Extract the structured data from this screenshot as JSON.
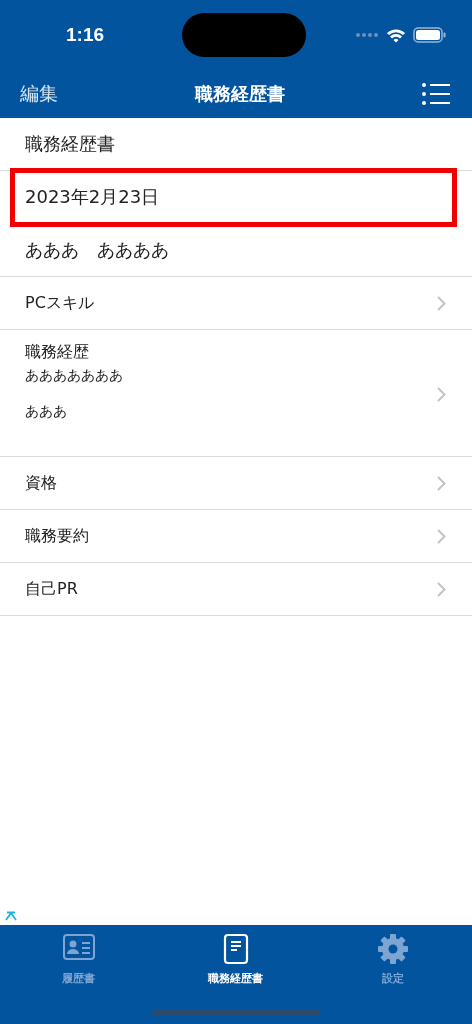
{
  "status_bar": {
    "time": "1:16"
  },
  "nav_bar": {
    "left": "編集",
    "title": "職務経歴書"
  },
  "rows": [
    {
      "kind": "plain",
      "label": "職務経歴書",
      "highlighted": false
    },
    {
      "kind": "plain",
      "label": "2023年2月23日",
      "highlighted": true
    },
    {
      "kind": "plain",
      "label": "あああ　ああああ",
      "highlighted": false
    },
    {
      "kind": "link",
      "label": "PCスキル",
      "highlighted": false
    },
    {
      "kind": "link",
      "label": "職務経歴",
      "highlighted": false,
      "details": [
        "あああああああ",
        "あああ"
      ]
    },
    {
      "kind": "link",
      "label": "資格",
      "highlighted": false
    },
    {
      "kind": "link",
      "label": "職務要約",
      "highlighted": false
    },
    {
      "kind": "link",
      "label": "自己PR",
      "highlighted": false
    }
  ],
  "tabs": [
    {
      "kind": "card",
      "label": "履歴書",
      "selected": false
    },
    {
      "kind": "document",
      "label": "職務経歴書",
      "selected": true
    },
    {
      "kind": "gear",
      "label": "設定",
      "selected": false
    }
  ]
}
